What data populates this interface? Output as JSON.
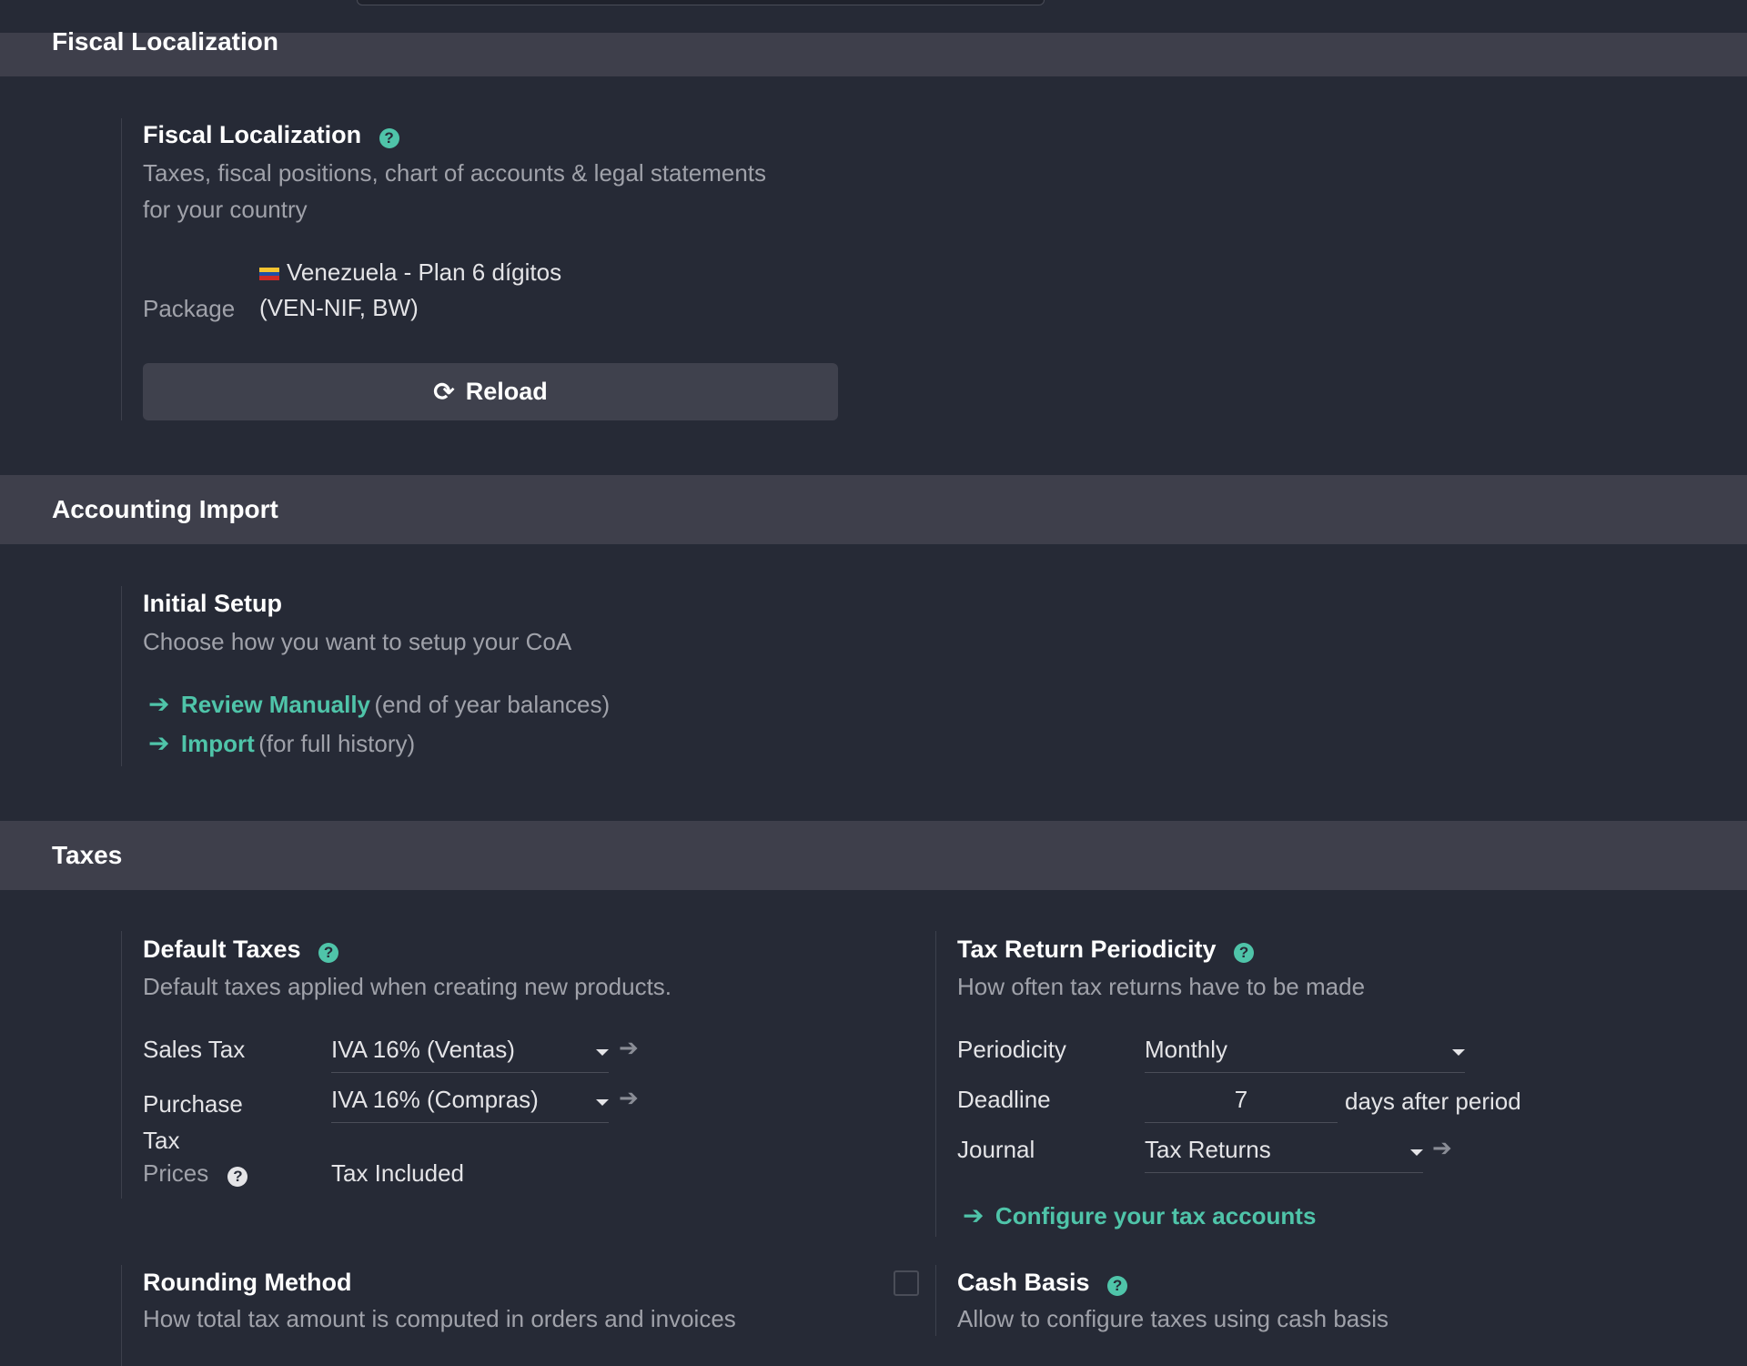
{
  "sections": {
    "fiscal_title": "Fiscal Localization",
    "import_title": "Accounting Import",
    "taxes_title": "Taxes"
  },
  "fiscal": {
    "title": "Fiscal Localization",
    "desc_line1": "Taxes, fiscal positions, chart of accounts & legal statements",
    "desc_line2": "for your country",
    "package_label": "Package",
    "package_value_line1": "Venezuela - Plan 6 dígitos",
    "package_value_line2": "(VEN-NIF, BW)",
    "flag_colors": [
      "#f4c430",
      "#1f4fa6",
      "#cf2a27"
    ],
    "reload_label": "Reload"
  },
  "initial_setup": {
    "title": "Initial Setup",
    "desc": "Choose how you want to setup your CoA",
    "review_link": "Review Manually",
    "review_note": "(end of year balances)",
    "import_link": "Import",
    "import_note": "(for full history)"
  },
  "default_taxes": {
    "title": "Default Taxes",
    "desc": "Default taxes applied when creating new products.",
    "sales_label": "Sales Tax",
    "sales_value": "IVA 16% (Ventas)",
    "purchase_label_line1": "Purchase",
    "purchase_label_line2": "Tax",
    "purchase_value": "IVA 16% (Compras)",
    "prices_label": "Prices",
    "prices_value": "Tax Included"
  },
  "periodicity": {
    "title": "Tax Return Periodicity",
    "desc": "How often tax returns have to be made",
    "periodicity_label": "Periodicity",
    "periodicity_value": "Monthly",
    "deadline_label": "Deadline",
    "deadline_value": "7",
    "deadline_suffix": "days after period",
    "journal_label": "Journal",
    "journal_value": "Tax Returns",
    "configure_link": "Configure your tax accounts"
  },
  "rounding": {
    "title": "Rounding Method",
    "desc": "How total tax amount is computed in orders and invoices"
  },
  "cash_basis": {
    "title": "Cash Basis",
    "desc": "Allow to configure taxes using cash basis",
    "checked": false
  },
  "colors": {
    "accent": "#4fc4a9",
    "background": "#262a36",
    "section_bar": "#3e3f4b"
  }
}
